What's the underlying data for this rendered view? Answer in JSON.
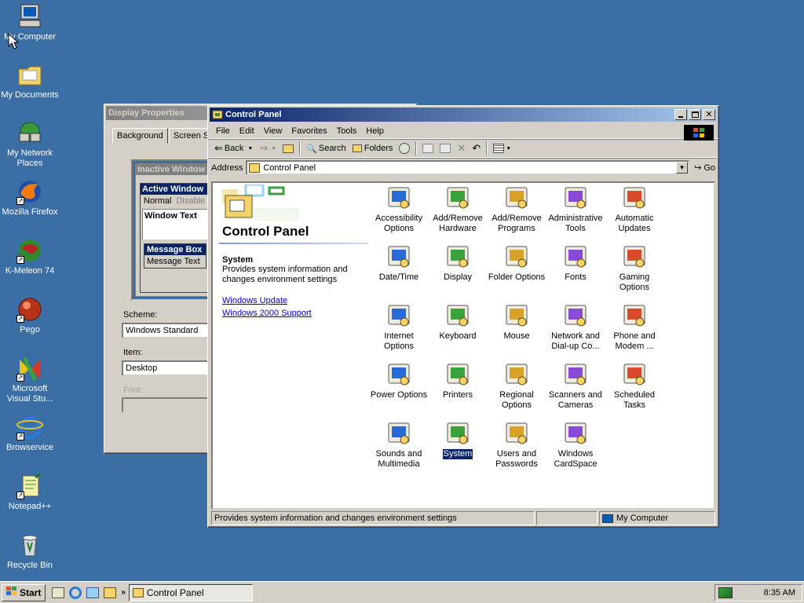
{
  "desktop": {
    "icons": [
      {
        "label": "My Computer",
        "icon": "computer-icon"
      },
      {
        "label": "My Documents",
        "icon": "folder-icon"
      },
      {
        "label": "My Network Places",
        "icon": "network-icon"
      },
      {
        "label": "Mozilla Firefox",
        "icon": "firefox-icon"
      },
      {
        "label": "K-Meleon 74",
        "icon": "kmeleon-icon"
      },
      {
        "label": "Pego",
        "icon": "pego-icon"
      },
      {
        "label": "Microsoft Visual Stu...",
        "icon": "visual-studio-icon"
      },
      {
        "label": "Browservice",
        "icon": "ie-icon"
      },
      {
        "label": "Notepad++",
        "icon": "notepad-icon"
      },
      {
        "label": "Recycle Bin",
        "icon": "recycle-bin-icon"
      }
    ]
  },
  "display_properties": {
    "title": "Display Properties",
    "tabs": [
      "Background",
      "Screen S"
    ],
    "preview": {
      "inactive_window": "Inactive Window",
      "active_window": "Active Window",
      "normal": "Normal",
      "disabled": "Disable",
      "window_text": "Window Text",
      "message_box": "Message Box",
      "message_text": "Message Text"
    },
    "scheme_label": "Scheme:",
    "scheme_value": "Windows Standard",
    "item_label": "Item:",
    "item_value": "Desktop",
    "font_label": "Font:"
  },
  "control_panel": {
    "title": "Control Panel",
    "menu": [
      "File",
      "Edit",
      "View",
      "Favorites",
      "Tools",
      "Help"
    ],
    "toolbar": {
      "back": "Back",
      "search": "Search",
      "folders": "Folders"
    },
    "address_label": "Address",
    "address_value": "Control Panel",
    "go_label": "Go",
    "heading": "Control Panel",
    "selected_title": "System",
    "selected_desc": "Provides system information and changes environment settings",
    "links": [
      "Windows Update",
      "Windows 2000 Support"
    ],
    "items": [
      {
        "label": "Accessibility Options",
        "icon": "accessibility-icon"
      },
      {
        "label": "Add/Remove Hardware",
        "icon": "hardware-icon"
      },
      {
        "label": "Add/Remove Programs",
        "icon": "programs-icon"
      },
      {
        "label": "Administrative Tools",
        "icon": "admin-tools-icon"
      },
      {
        "label": "Automatic Updates",
        "icon": "windows-update-icon"
      },
      {
        "label": "Date/Time",
        "icon": "date-time-icon"
      },
      {
        "label": "Display",
        "icon": "display-icon"
      },
      {
        "label": "Folder Options",
        "icon": "folder-options-icon"
      },
      {
        "label": "Fonts",
        "icon": "fonts-icon"
      },
      {
        "label": "Gaming Options",
        "icon": "gaming-icon"
      },
      {
        "label": "Internet Options",
        "icon": "internet-icon"
      },
      {
        "label": "Keyboard",
        "icon": "keyboard-icon"
      },
      {
        "label": "Mouse",
        "icon": "mouse-icon"
      },
      {
        "label": "Network and Dial-up Co...",
        "icon": "network-connections-icon"
      },
      {
        "label": "Phone and Modem ...",
        "icon": "phone-icon"
      },
      {
        "label": "Power Options",
        "icon": "power-icon"
      },
      {
        "label": "Printers",
        "icon": "printer-icon"
      },
      {
        "label": "Regional Options",
        "icon": "globe-icon"
      },
      {
        "label": "Scanners and Cameras",
        "icon": "scanner-icon"
      },
      {
        "label": "Scheduled Tasks",
        "icon": "scheduled-tasks-icon"
      },
      {
        "label": "Sounds and Multimedia",
        "icon": "sound-icon"
      },
      {
        "label": "System",
        "icon": "system-icon",
        "selected": true
      },
      {
        "label": "Users and Passwords",
        "icon": "users-icon"
      },
      {
        "label": "Windows CardSpace",
        "icon": "cardspace-icon"
      }
    ],
    "status_text": "Provides system information and changes environment settings",
    "status_zone": "My Computer"
  },
  "taskbar": {
    "start_label": "Start",
    "task_label": "Control Panel",
    "clock": "8:35 AM"
  },
  "colors": {
    "desktop": "#3a6ea5",
    "title_active": "#0a246a",
    "link": "#0000cc"
  }
}
